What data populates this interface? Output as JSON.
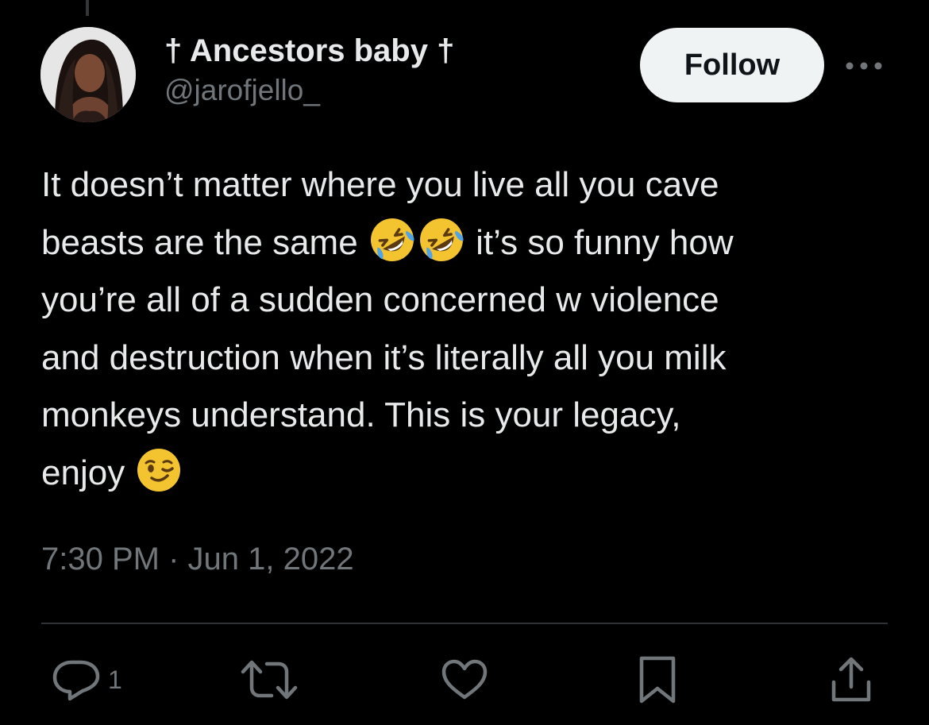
{
  "tweet": {
    "display_name": "† Ancestors baby †",
    "handle": "@jarofjello_",
    "follow_label": "Follow",
    "text_lines": [
      [
        "It doesn’t matter where you live all you cave"
      ],
      [
        "beasts are the same ",
        " it’s so funny how"
      ],
      [
        "you’re all of a sudden concerned w violence"
      ],
      [
        "and destruction when it’s literally all you milk"
      ],
      [
        "monkeys understand. This is your legacy,"
      ],
      [
        "enjoy "
      ]
    ],
    "emojis": [
      "rolling-on-floor-laughing",
      "rolling-on-floor-laughing",
      "winking-face"
    ],
    "timestamp": "7:30 PM · Jun 1, 2022"
  },
  "actions": {
    "reply_count": "1",
    "icons": [
      "reply-icon",
      "retweet-icon",
      "like-icon",
      "bookmark-icon",
      "share-icon"
    ]
  },
  "colors": {
    "background": "#000000",
    "primary_text": "#e7e9ea",
    "secondary_text": "#71767b",
    "follow_bg": "#eff3f4",
    "divider": "#2f3336"
  }
}
